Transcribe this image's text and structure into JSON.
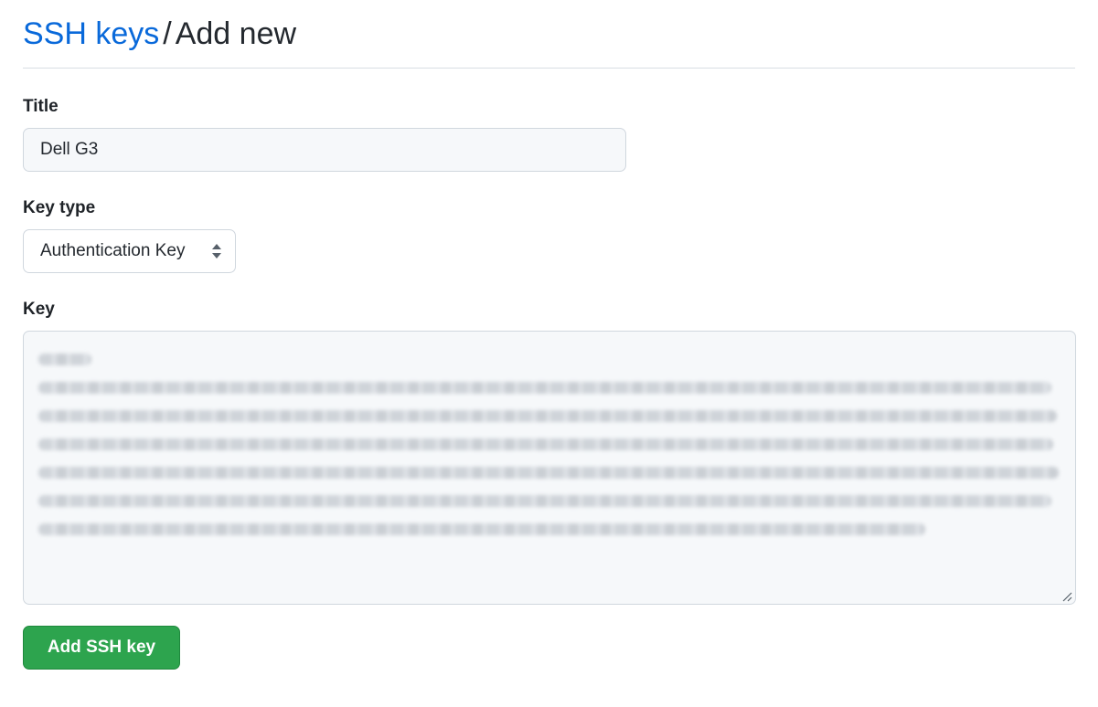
{
  "breadcrumb": {
    "parent": "SSH keys",
    "separator": "/",
    "current": "Add new"
  },
  "form": {
    "title_label": "Title",
    "title_value": "Dell G3",
    "key_type_label": "Key type",
    "key_type_value": "Authentication Key",
    "key_label": "Key",
    "key_value_blurred": true,
    "submit_label": "Add SSH key"
  },
  "colors": {
    "link": "#0969da",
    "primary_button": "#2da44e",
    "input_bg": "#f6f8fa"
  },
  "icons": {
    "select": "updown-arrows-icon",
    "textarea": "resize-handle-icon"
  }
}
